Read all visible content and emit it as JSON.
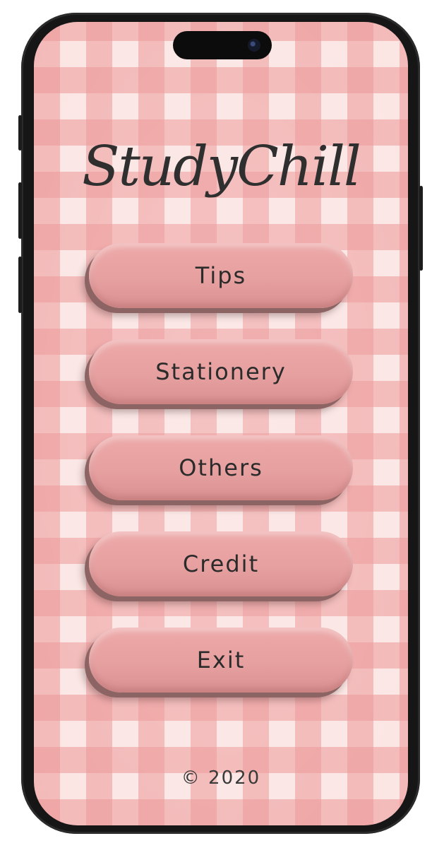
{
  "app": {
    "title": "StudyChill"
  },
  "menu": {
    "items": [
      {
        "label": "Tips"
      },
      {
        "label": "Stationery"
      },
      {
        "label": "Others"
      },
      {
        "label": "Credit"
      },
      {
        "label": "Exit"
      }
    ]
  },
  "footer": {
    "copyright": "© 2020"
  },
  "colors": {
    "button": "#e9a3a3",
    "button_shadow": "#8d6464",
    "gingham_pink": "#ec9696",
    "background": "#fbe6e4",
    "text": "#2b2b2b"
  }
}
